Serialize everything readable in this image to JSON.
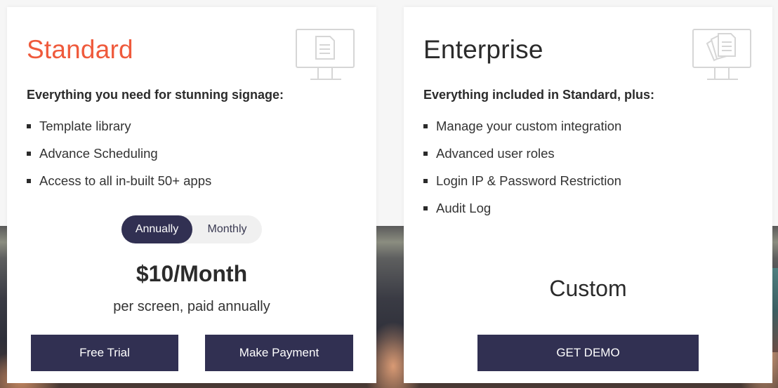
{
  "plans": [
    {
      "title": "Standard",
      "icon": "monitor-document-icon",
      "subtitle": "Everything you need for stunning signage:",
      "features": [
        "Template library",
        "Advance Scheduling",
        "Access to all in-built 50+ apps"
      ],
      "billing_toggle": {
        "options": [
          "Annually",
          "Monthly"
        ],
        "selected": "Annually"
      },
      "price": "$10/Month",
      "price_note": "per screen, paid annually",
      "buttons": [
        "Free Trial",
        "Make Payment"
      ]
    },
    {
      "title": "Enterprise",
      "icon": "monitor-documents-icon",
      "subtitle": "Everything included in Standard, plus:",
      "features": [
        "Manage your custom integration",
        "Advanced user roles",
        "Login IP & Password Restriction",
        "Audit Log"
      ],
      "price": "Custom",
      "buttons": [
        "GET DEMO"
      ]
    }
  ],
  "colors": {
    "accent": "#ef5a3c",
    "button": "#313052",
    "toggle_bg": "#f0f0f0"
  }
}
